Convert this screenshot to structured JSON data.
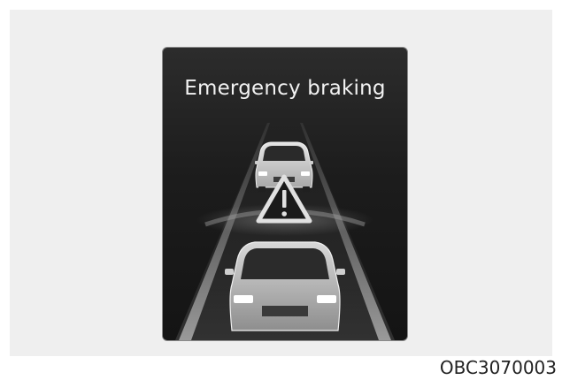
{
  "figure": {
    "panel_title": "Emergency braking",
    "caption_code": "OBC3070003"
  },
  "icons": {
    "warning": "warning-triangle-icon",
    "lead_vehicle": "car-rear-view-icon",
    "own_vehicle": "car-rear-view-icon"
  },
  "colors": {
    "panel_background": "#1c1c1c",
    "title_text": "#f2f2f2",
    "lane_lines": "#9a9a9a",
    "warning_triangle": "#e0e0e0"
  }
}
